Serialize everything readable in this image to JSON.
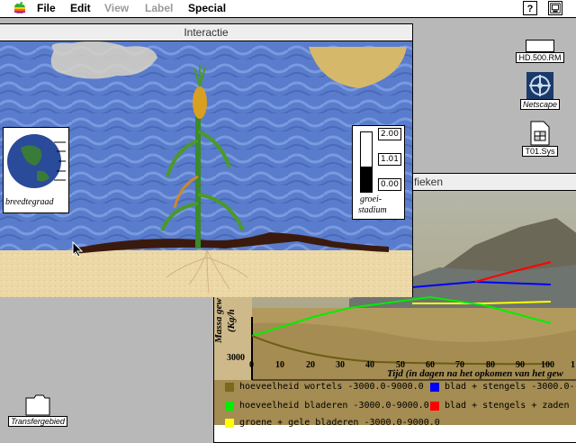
{
  "menubar": {
    "items": [
      {
        "label": "File",
        "enabled": true
      },
      {
        "label": "Edit",
        "enabled": true
      },
      {
        "label": "View",
        "enabled": false
      },
      {
        "label": "Label",
        "enabled": false
      },
      {
        "label": "Special",
        "enabled": true
      }
    ],
    "help_icon": "?",
    "app_icon": "finder-icon"
  },
  "interactie": {
    "title": "Interactie",
    "latitude_label": "breedtegraad",
    "growth_label_line1": "groei-",
    "growth_label_line2": "stadium",
    "growth_ticks": [
      "2.00",
      "1.01",
      "0.00"
    ],
    "growth_value": 0.85
  },
  "grafieken": {
    "title_fragment": "fieken",
    "y_label_line1": "Massa gew",
    "y_label_line2": "(Kg/h",
    "y_bottom_tick": "3000",
    "x_ticks": [
      "0",
      "10",
      "20",
      "30",
      "40",
      "50",
      "60",
      "70",
      "80",
      "90",
      "100",
      "1"
    ],
    "x_label": "Tijd (in dagen na het opkomen van het gew",
    "legend": [
      {
        "label": "hoeveelheid wortels -3000.0-9000.0",
        "color": "#7a6a1a"
      },
      {
        "label": "blad + stengels -3000.0-",
        "color": "#0000ff"
      },
      {
        "label": "hoeveelheid bladeren -3000.0-9000.0",
        "color": "#00ee00"
      },
      {
        "label": "blad + stengels + zaden -3000",
        "color": "#ff0000"
      },
      {
        "label": "groene + gele bladeren -3000.0-9000.0",
        "color": "#ffff00"
      }
    ]
  },
  "desktop": {
    "icons": [
      {
        "label": "HD.500.RM",
        "italic": false,
        "icon": "hard-disk-icon"
      },
      {
        "label": "Netscape",
        "italic": true,
        "icon": "netscape-icon"
      },
      {
        "label": "T01.Sys",
        "italic": false,
        "icon": "file-icon"
      },
      {
        "label": "Transfergebied",
        "italic": true,
        "icon": "folder-icon"
      }
    ]
  }
}
